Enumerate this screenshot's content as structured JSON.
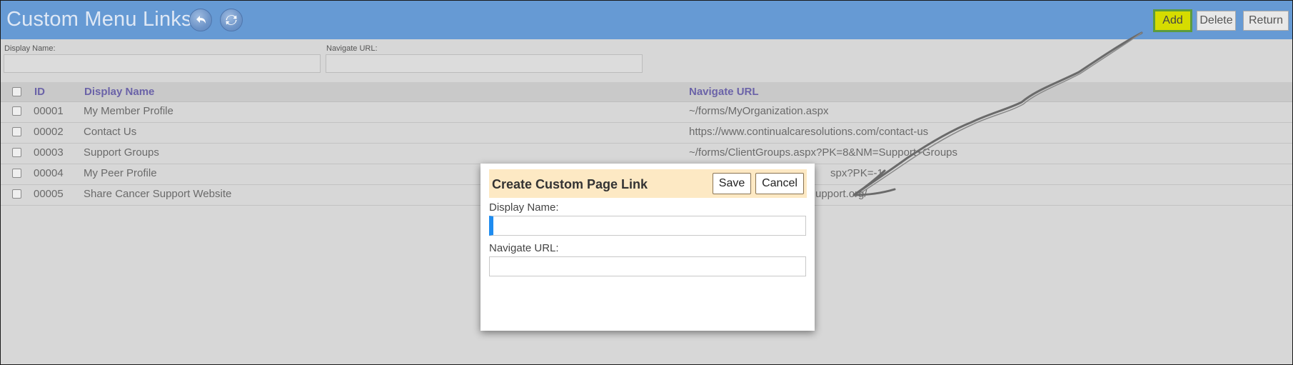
{
  "header": {
    "title": "Custom Menu Links",
    "back_icon": "undo-arrow-icon",
    "refresh_icon": "refresh-icon",
    "add_label": "Add",
    "delete_label": "Delete",
    "return_label": "Return"
  },
  "filters": {
    "display_name_label": "Display Name:",
    "navigate_url_label": "Navigate URL:",
    "display_name_value": "",
    "navigate_url_value": ""
  },
  "table": {
    "columns": [
      "ID",
      "Display Name",
      "Navigate URL"
    ],
    "rows": [
      {
        "id": "00001",
        "name": "My Member Profile",
        "url": "~/forms/MyOrganization.aspx"
      },
      {
        "id": "00002",
        "name": "Contact Us",
        "url": "https://www.continualcaresolutions.com/contact-us"
      },
      {
        "id": "00003",
        "name": "Support Groups",
        "url": "~/forms/ClientGroups.aspx?PK=8&NM=Support+Groups"
      },
      {
        "id": "00004",
        "name": "My Peer Profile",
        "url": "spx?PK=-1"
      },
      {
        "id": "00005",
        "name": "Share Cancer Support Website",
        "url": "upport.org/"
      }
    ]
  },
  "dialog": {
    "title": "Create Custom Page Link",
    "save_label": "Save",
    "cancel_label": "Cancel",
    "display_name_label": "Display Name:",
    "navigate_url_label": "Navigate URL:",
    "display_name_value": "",
    "navigate_url_value": ""
  },
  "colors": {
    "header_bg": "#669ad4",
    "add_highlight": "#d6dc00",
    "dialog_bar": "#fde9c4",
    "column_header_text": "#6b63a8",
    "focus_accent": "#1f8cf0"
  }
}
